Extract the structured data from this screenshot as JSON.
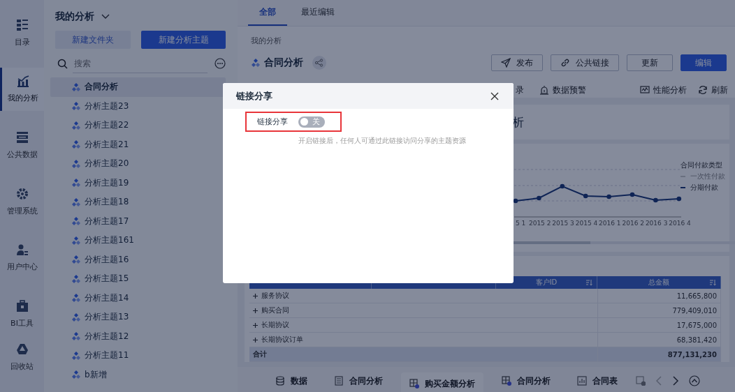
{
  "nav_rail": {
    "items": [
      {
        "label": "目录",
        "selected": false
      },
      {
        "label": "我的分析",
        "selected": true
      },
      {
        "label": "公共数据",
        "selected": false
      },
      {
        "label": "管理系统",
        "selected": false
      },
      {
        "label": "用户中心",
        "selected": false
      },
      {
        "label": "BI工具",
        "selected": false
      },
      {
        "label": "回收站",
        "selected": false
      }
    ]
  },
  "folder_panel": {
    "title": "我的分析",
    "buttons": [
      {
        "label": "新建文件夹",
        "kind": "secondary"
      },
      {
        "label": "新建分析主题",
        "kind": "primary"
      }
    ],
    "search": {
      "placeholder": "搜索"
    },
    "items": [
      {
        "label": "合同分析",
        "selected": true
      },
      {
        "label": "分析主题23",
        "selected": false
      },
      {
        "label": "分析主题22",
        "selected": false
      },
      {
        "label": "分析主题21",
        "selected": false
      },
      {
        "label": "分析主题20",
        "selected": false
      },
      {
        "label": "分析主题19",
        "selected": false
      },
      {
        "label": "分析主题18",
        "selected": false
      },
      {
        "label": "分析主题17",
        "selected": false
      },
      {
        "label": "分析主题161",
        "selected": false
      },
      {
        "label": "分析主题16",
        "selected": false
      },
      {
        "label": "分析主题15",
        "selected": false
      },
      {
        "label": "分析主题14",
        "selected": false
      },
      {
        "label": "分析主题13",
        "selected": false
      },
      {
        "label": "分析主题12",
        "selected": false
      },
      {
        "label": "分析主题11",
        "selected": false
      },
      {
        "label": "b新增",
        "selected": false
      }
    ]
  },
  "main": {
    "tabs": [
      {
        "label": "全部",
        "selected": true
      },
      {
        "label": "最近编辑",
        "selected": false
      }
    ],
    "breadcrumb": "我的分析",
    "title": "合同分析",
    "actions": [
      {
        "label": "发布",
        "kind": "default"
      },
      {
        "label": "公共链接",
        "kind": "default"
      },
      {
        "label": "更新",
        "kind": "default"
      },
      {
        "label": "编辑",
        "kind": "primary"
      }
    ],
    "toolbar_left": [
      "录",
      "数据预警"
    ],
    "toolbar_right": [
      "性能分析",
      "刷新"
    ]
  },
  "dashboard": {
    "title_card": "析",
    "chart": {
      "x_labels": [
        "5 1",
        "2015 2",
        "2015 3",
        "2015 4",
        "2016 1",
        "2016 2",
        "2016 3",
        "2016 4"
      ],
      "legend_title": "合同付款类型",
      "legend": [
        {
          "label": "一次性付款",
          "on": false
        },
        {
          "label": "分期付款",
          "on": true
        }
      ]
    },
    "table": {
      "columns": [
        "客户ID",
        "总金额"
      ],
      "rows": [
        {
          "group": "服务协议",
          "total": "11,665,800"
        },
        {
          "group": "购买合同",
          "total": "779,409,010"
        },
        {
          "group": "长期协议",
          "total": "17,675,000"
        },
        {
          "group": "长期协议订单",
          "total": "68,381,420"
        }
      ],
      "total_row": {
        "label": "合计",
        "total": "877,131,230"
      }
    }
  },
  "bottom_tabs": [
    {
      "label": "数据",
      "selected": false
    },
    {
      "label": "合同分析",
      "selected": false
    },
    {
      "label": "购买金额分析",
      "selected": true
    },
    {
      "label": "合同分析",
      "selected": false
    },
    {
      "label": "合同表",
      "selected": false
    }
  ],
  "modal": {
    "title": "链接分享",
    "toggle": {
      "label": "链接分享",
      "on": false,
      "state_text": "关"
    },
    "hint": "开启链接后，任何人可通过此链接访问分享的主题资源"
  }
}
